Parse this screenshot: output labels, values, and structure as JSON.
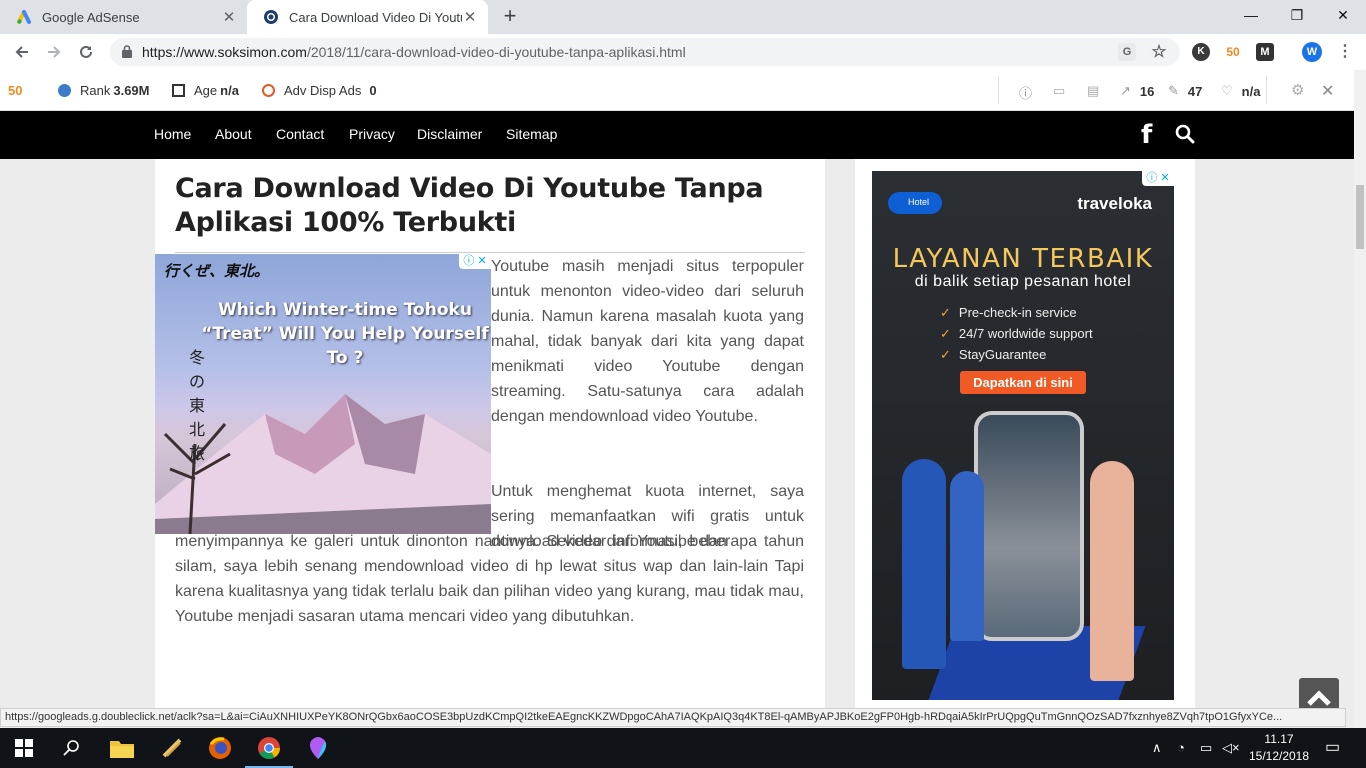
{
  "browser": {
    "tabs": [
      {
        "title": "Google AdSense",
        "active": false
      },
      {
        "title": "Cara Download Video Di Youtube",
        "active": true
      }
    ],
    "new_tab": "+",
    "window_controls": {
      "minimize": "—",
      "maximize": "❐",
      "close": "✕"
    },
    "url_host": "https://www.soksimon.com",
    "url_path": "/2018/11/cara-download-video-di-youtube-tanpa-aplikasi.html",
    "profile_initial": "W",
    "ext_k_initial": "K"
  },
  "extension_bar": {
    "rank_label": "Rank",
    "rank_value": "3.69M",
    "age_label": "Age",
    "age_value": "n/a",
    "adv_label": "Adv Disp Ads",
    "adv_value": "0",
    "ext_links": "16",
    "ext_pages": "47",
    "ext_trust": "n/a"
  },
  "site_nav": {
    "items": [
      "Home",
      "About",
      "Contact",
      "Privacy",
      "Disclaimer",
      "Sitemap"
    ]
  },
  "article": {
    "title": "Cara Download Video Di Youtube Tanpa Aplikasi 100% Terbukti",
    "p1": "Youtube masih menjadi situs terpopuler untuk menonton video-video dari seluruh dunia. Namun karena masalah kuota yang mahal, tidak banyak dari kita yang dapat menikmati video Youtube dengan streaming. Satu-satunya cara adalah dengan mendownload video Youtube.",
    "p2": "Untuk menghemat kuota internet, saya sering memanfaatkan wifi gratis untuk download video dari Youtube dan",
    "p3": "menyimpannya ke galeri untuk dinonton nantinya. Sekedar informasi, beberapa tahun silam, saya lebih senang mendownload video di hp lewat situs wap dan lain-lain Tapi karena kualitasnya yang tidak terlalu baik dan pilihan video yang kurang, mau tidak mau, Youtube menjadi sasaran utama mencari video yang dibutuhkan."
  },
  "ad_left": {
    "logo": "行くぜ、東北。",
    "headline": "Which Winter-time Tohoku “Treat” Will You Help Yourself To ?",
    "vertical_text": "冬の東北旅"
  },
  "ad_right": {
    "brand": "traveloka",
    "badge": "Hotel",
    "headline": "LAYANAN TERBAIK",
    "subheadline": "di balik setiap pesanan hotel",
    "features": [
      "Pre-check-in service",
      "24/7 worldwide support",
      "StayGuarantee"
    ],
    "cta": "Dapatkan di sini"
  },
  "status_bar": {
    "text": "https://googleads.g.doubleclick.net/aclk?sa=L&ai=CiAuXNHIUXPeYK8ONrQGbx6aoCOSE3bpUzdKCmpQI2tkeEAEgncKKZWDpgoCAhA7IAQKpAIQ3q4KT8El-qAMByAPJBKoE2gFP0Hgb-hRDqaiA5kIrPrUQpgQuTmGnnQOzSAD7fxznhye8ZVqh7tpO1GfyxYCe..."
  },
  "taskbar": {
    "time": "11.17",
    "date": "15/12/2018"
  },
  "colors": {
    "nav_bg": "#000000",
    "ad_gold": "#f2c75c",
    "cta_orange": "#f05a24"
  }
}
